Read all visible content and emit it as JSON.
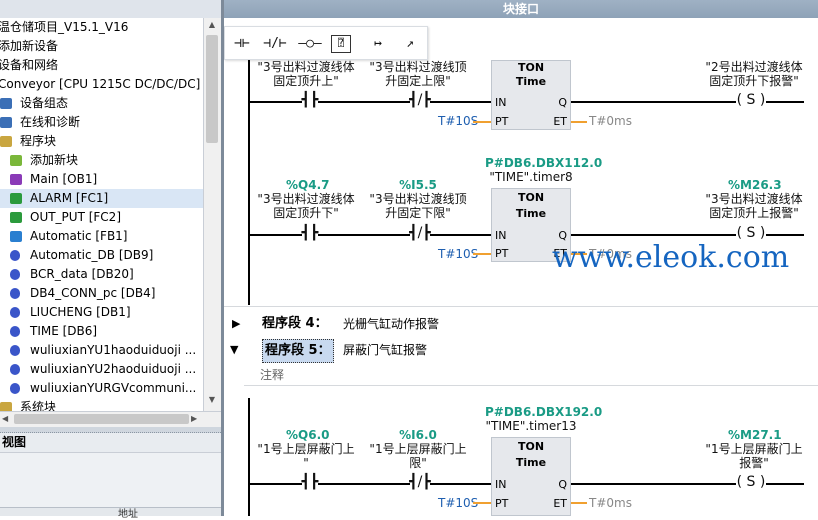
{
  "tree": {
    "items": [
      {
        "label": "温仓储项目_V15.1_V16",
        "indent": 0,
        "icon": "none",
        "color": "#000"
      },
      {
        "label": "添加新设备",
        "indent": 0,
        "icon": "none",
        "color": "#000"
      },
      {
        "label": "设备和网络",
        "indent": 0,
        "icon": "none",
        "color": "#000"
      },
      {
        "label": "Conveyor [CPU 1215C DC/DC/DC]",
        "indent": 0,
        "icon": "none",
        "color": "#000"
      },
      {
        "label": "设备组态",
        "indent": 1,
        "icon": "device-config-icon",
        "color": "#3b6fb6"
      },
      {
        "label": "在线和诊断",
        "indent": 1,
        "icon": "online-diagnostics-icon",
        "color": "#3b6fb6"
      },
      {
        "label": "程序块",
        "indent": 1,
        "icon": "folder-icon",
        "color": "#c9a640"
      },
      {
        "label": "添加新块",
        "indent": 2,
        "icon": "add-block-icon",
        "color": "#7ab73a"
      },
      {
        "label": "Main [OB1]",
        "indent": 2,
        "icon": "ob-block-icon",
        "color": "#8a3ab7"
      },
      {
        "label": "ALARM [FC1]",
        "indent": 2,
        "icon": "fc-block-icon",
        "color": "#2b9a3c"
      },
      {
        "label": "OUT_PUT [FC2]",
        "indent": 2,
        "icon": "fc-block-icon",
        "color": "#2b9a3c"
      },
      {
        "label": "Automatic [FB1]",
        "indent": 2,
        "icon": "fb-block-icon",
        "color": "#2a7fd0"
      },
      {
        "label": "Automatic_DB [DB9]",
        "indent": 2,
        "icon": "db-block-icon",
        "color": "#3a55c9"
      },
      {
        "label": "BCR_data [DB20]",
        "indent": 2,
        "icon": "db-block-icon",
        "color": "#3a55c9"
      },
      {
        "label": "DB4_CONN_pc [DB4]",
        "indent": 2,
        "icon": "db-block-icon",
        "color": "#3a55c9"
      },
      {
        "label": "LIUCHENG [DB1]",
        "indent": 2,
        "icon": "db-block-icon",
        "color": "#3a55c9"
      },
      {
        "label": "TIME [DB6]",
        "indent": 2,
        "icon": "db-block-icon",
        "color": "#3a55c9"
      },
      {
        "label": "wuliuxianYU1haoduiduoji ...",
        "indent": 2,
        "icon": "db-block-icon",
        "color": "#3a55c9"
      },
      {
        "label": "wuliuxianYU2haoduiduoji ...",
        "indent": 2,
        "icon": "db-block-icon",
        "color": "#3a55c9"
      },
      {
        "label": "wuliuxianYURGVcommuni...",
        "indent": 2,
        "icon": "db-block-icon",
        "color": "#3a55c9"
      },
      {
        "label": "系统块",
        "indent": 1,
        "icon": "folder-icon",
        "color": "#c9a640"
      }
    ],
    "selected_index": 9
  },
  "detail_view": {
    "title": "视图",
    "column": "地址"
  },
  "editor": {
    "title": "块接口",
    "toolbar": [
      "⊣⊢",
      "⊣/⊢",
      "–○–",
      "⍰",
      "↦",
      "↗"
    ],
    "net1": {
      "contact1_label": "\"3号出料过渡线体\n固定顶升上\"",
      "contact2_label": "\"3号出料过渡线顶\n升固定上限\"",
      "ton_head": "TON",
      "ton_sub": "Time",
      "pt": "T#10S",
      "et": "T#0ms",
      "coil_label": "\"2号出料过渡线体\n固定顶升下报警\""
    },
    "net2": {
      "instance_addr": "P#DB6.DBX112.0",
      "instance_name": "\"TIME\".timer8",
      "contact1_addr": "%Q4.7",
      "contact1_label": "\"3号出料过渡线体\n固定顶升下\"",
      "contact2_addr": "%I5.5",
      "contact2_label": "\"3号出料过渡线顶\n升固定下限\"",
      "ton_head": "TON",
      "ton_sub": "Time",
      "pt": "T#10S",
      "et": "T#0ms",
      "coil_addr": "%M26.3",
      "coil_label": "\"3号出料过渡线体\n固定顶升上报警\""
    },
    "segments": [
      {
        "title": "程序段 4：",
        "desc": "光栅气缸动作报警",
        "expanded": false
      },
      {
        "title": "程序段 5：",
        "desc": "屏蔽门气缸报警",
        "expanded": true
      }
    ],
    "comment": "注释",
    "net3": {
      "instance_addr": "P#DB6.DBX192.0",
      "instance_name": "\"TIME\".timer13",
      "contact1_addr": "%Q6.0",
      "contact1_label": "\"1号上层屏蔽门上\n\"",
      "contact2_addr": "%I6.0",
      "contact2_label": "\"1号上层屏蔽门上\n限\"",
      "ton_head": "TON",
      "ton_sub": "Time",
      "pt": "T#10S",
      "et": "T#0ms",
      "coil_addr": "%M27.1",
      "coil_label": "\"1号上层屏蔽门上\n报警\""
    },
    "pins": {
      "in": "IN",
      "pt": "PT",
      "q": "Q",
      "et": "ET",
      "coil": "S"
    },
    "watermark": "www.eleok.com"
  }
}
